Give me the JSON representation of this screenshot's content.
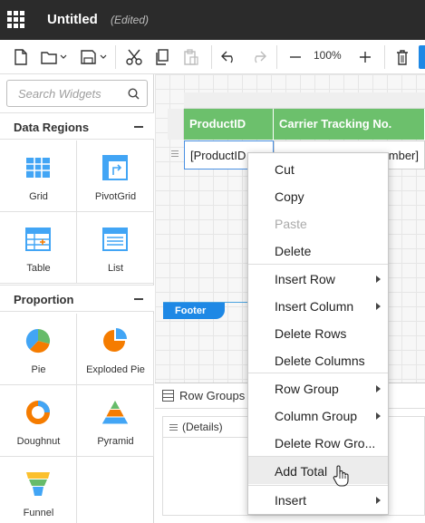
{
  "titlebar": {
    "title": "Untitled",
    "edited": "(Edited)"
  },
  "toolbar": {
    "zoom": "100%"
  },
  "search": {
    "placeholder": "Search Widgets"
  },
  "sections": [
    {
      "label": "Data Regions",
      "widgets": [
        {
          "label": "Grid",
          "icon": "grid-icon"
        },
        {
          "label": "PivotGrid",
          "icon": "pivotgrid-icon"
        },
        {
          "label": "Table",
          "icon": "table-icon"
        },
        {
          "label": "List",
          "icon": "list-icon"
        }
      ]
    },
    {
      "label": "Proportion",
      "widgets": [
        {
          "label": "Pie",
          "icon": "pie-icon"
        },
        {
          "label": "Exploded Pie",
          "icon": "exploded-pie-icon"
        },
        {
          "label": "Doughnut",
          "icon": "doughnut-icon"
        },
        {
          "label": "Pyramid",
          "icon": "pyramid-icon"
        },
        {
          "label": "Funnel",
          "icon": "funnel-icon"
        }
      ]
    }
  ],
  "table": {
    "headers": [
      "ProductID",
      "Carrier Tracking No."
    ],
    "cells": [
      "[ProductID",
      "mber]"
    ]
  },
  "footer": {
    "label": "Footer"
  },
  "row_groups": {
    "title": "Row Groups",
    "details": "(Details)"
  },
  "context_menu": {
    "items": [
      {
        "label": "Cut"
      },
      {
        "label": "Copy"
      },
      {
        "label": "Paste",
        "disabled": true
      },
      {
        "label": "Delete"
      },
      {
        "label": "Insert Row",
        "submenu": true
      },
      {
        "label": "Insert Column",
        "submenu": true
      },
      {
        "label": "Delete Rows"
      },
      {
        "label": "Delete Columns"
      },
      {
        "label": "Row Group",
        "submenu": true
      },
      {
        "label": "Column Group",
        "submenu": true
      },
      {
        "label": "Delete Row Gro..."
      },
      {
        "label": "Add Total",
        "hover": true
      },
      {
        "label": "Insert",
        "submenu": true
      }
    ]
  },
  "colors": {
    "accent": "#1e88e5",
    "header_green": "#6cc06c",
    "titlebar": "#2b2b2b"
  }
}
